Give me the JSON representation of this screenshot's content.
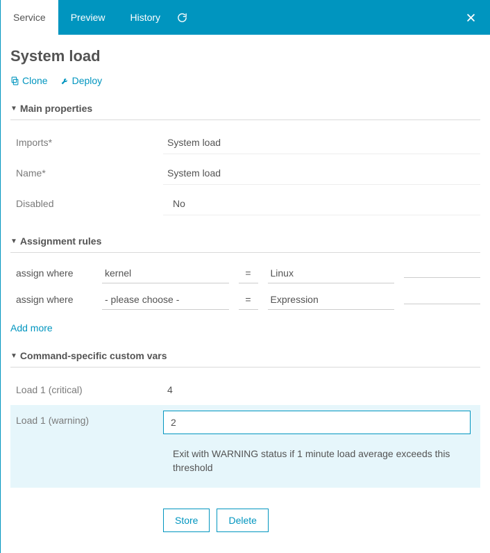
{
  "tabs": {
    "service": "Service",
    "preview": "Preview",
    "history": "History"
  },
  "page": {
    "title": "System load"
  },
  "toolbar": {
    "clone": "Clone",
    "deploy": "Deploy"
  },
  "sections": {
    "main": {
      "title": "Main properties",
      "imports_label": "Imports*",
      "imports_value": "System load",
      "name_label": "Name*",
      "name_value": "System load",
      "disabled_label": "Disabled",
      "disabled_value": "No"
    },
    "assign": {
      "title": "Assignment rules",
      "rows": [
        {
          "label": "assign where",
          "property": "kernel",
          "op": "=",
          "value": "Linux"
        },
        {
          "label": "assign where",
          "property": "- please choose -",
          "op": "=",
          "value": "Expression"
        }
      ],
      "add_more": "Add more"
    },
    "custom": {
      "title": "Command-specific custom vars",
      "load1_crit_label": "Load 1 (critical)",
      "load1_crit_value": "4",
      "load1_warn_label": "Load 1 (warning)",
      "load1_warn_value": "2",
      "load1_warn_hint": "Exit with WARNING status if 1 minute load average exceeds this threshold"
    }
  },
  "actions": {
    "store": "Store",
    "delete": "Delete"
  }
}
